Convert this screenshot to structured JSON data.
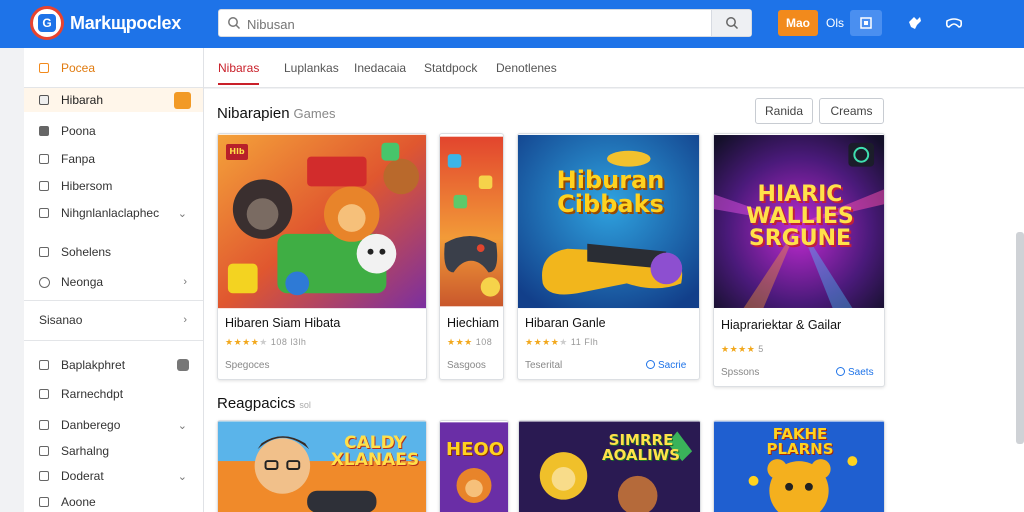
{
  "app": {
    "name": "Markщpoclex"
  },
  "search": {
    "placeholder": "Nibusan",
    "value": ""
  },
  "top": {
    "orange_btn": "Mao",
    "text": "Ols"
  },
  "sidebar": {
    "items": [
      {
        "label": "Pocea"
      },
      {
        "label": "Hibarah"
      },
      {
        "label": "Poona"
      },
      {
        "label": "Fanpa"
      },
      {
        "label": "Hibersom"
      },
      {
        "label": "Nihgnlanlaclaphec"
      },
      {
        "label": "Sohelens"
      },
      {
        "label": "Neonga"
      },
      {
        "label": "Sisanao"
      },
      {
        "label": "Baplakphret"
      },
      {
        "label": "Rarnechdpt"
      },
      {
        "label": "Danberego"
      },
      {
        "label": "Sarhalng"
      },
      {
        "label": "Doderat"
      },
      {
        "label": "Aoone"
      }
    ]
  },
  "tabs": [
    {
      "label": "Nibaras"
    },
    {
      "label": "Luplankas"
    },
    {
      "label": "Inedacaia"
    },
    {
      "label": "Statdpock"
    },
    {
      "label": "Denotlenes"
    }
  ],
  "section1": {
    "title": "Nibarapien",
    "subtitle": "Games",
    "btn1": "Ranida",
    "btn2": "Creams"
  },
  "cards": [
    {
      "title": "Hibaren Siam Hibata",
      "rating_text": "108 l3lh",
      "meta": "Spegoces",
      "link": ""
    },
    {
      "title": "Hiechiam",
      "rating_text": "108",
      "meta": "Sasgoos",
      "link": ""
    },
    {
      "title": "Hibaran Ganle",
      "rating_text": "11 Flh",
      "meta": "Teserital",
      "link": "Sacrie"
    },
    {
      "title": "Hiaprariektar & Gailar",
      "rating_text": "5",
      "meta": "Spssons",
      "link": "Saets"
    }
  ],
  "card_art": {
    "c1_badge": "Hlb",
    "c3_art_title": "Hiburan Cibbaks",
    "c4_art_title": "HIARIC WALLIES SRGUNE"
  },
  "section2": {
    "title": "Reagpacics",
    "subtitle": "sol"
  },
  "row2_art": {
    "a1": "CALDY XLANAES",
    "a2": "HEOO",
    "a3": "SIMRRE AOALIWS",
    "a4": "FAKHE PLARNS"
  },
  "colors": {
    "topbar": "#1e73e8",
    "accent_orange": "#f28a1c",
    "tab_active": "#c9202a",
    "link_blue": "#1e73e8",
    "star": "#f2a81d"
  }
}
